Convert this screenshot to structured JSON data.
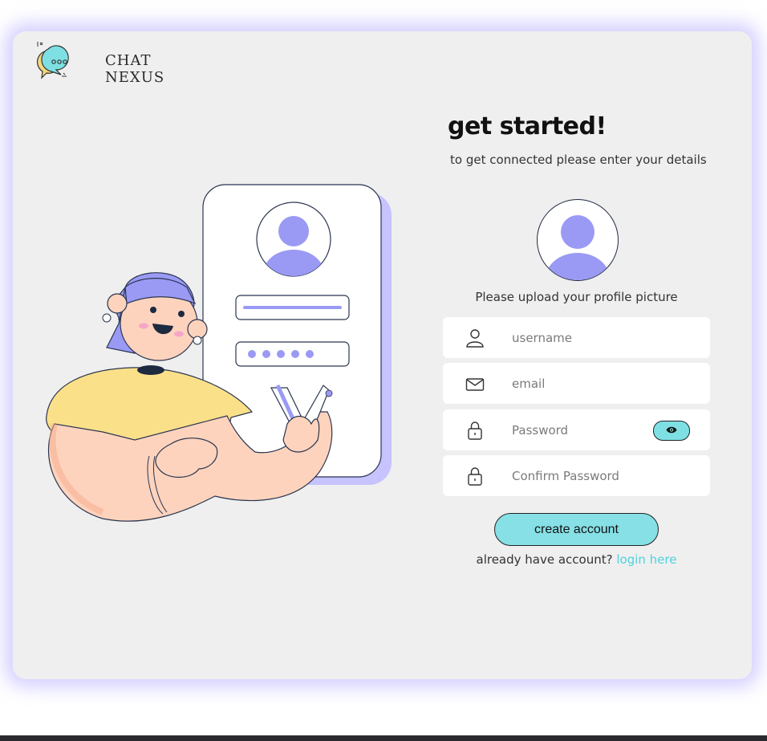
{
  "brand": {
    "line1": "CHAT",
    "line2": "NEXUS"
  },
  "signup": {
    "heading": "get started!",
    "subheading": "to get connected please enter your details",
    "upload_caption": "Please upload your profile picture",
    "fields": {
      "username_placeholder": "username",
      "email_placeholder": "email",
      "password_placeholder": "Password",
      "confirm_placeholder": "Confirm Password"
    },
    "submit_label": "create account",
    "login_prompt": "already have account?",
    "login_link": "login here"
  },
  "icons": {
    "logo": "chat-bubbles-logo-icon",
    "avatar": "user-avatar-icon",
    "username": "user-icon",
    "email": "envelope-icon",
    "password": "lock-icon",
    "confirm": "lock-icon",
    "toggle": "eye-icon"
  },
  "colors": {
    "accent_cyan": "#86e0e6",
    "accent_purple": "#9a9af5",
    "card_bg": "#efefef",
    "link": "#4ed2dd"
  }
}
